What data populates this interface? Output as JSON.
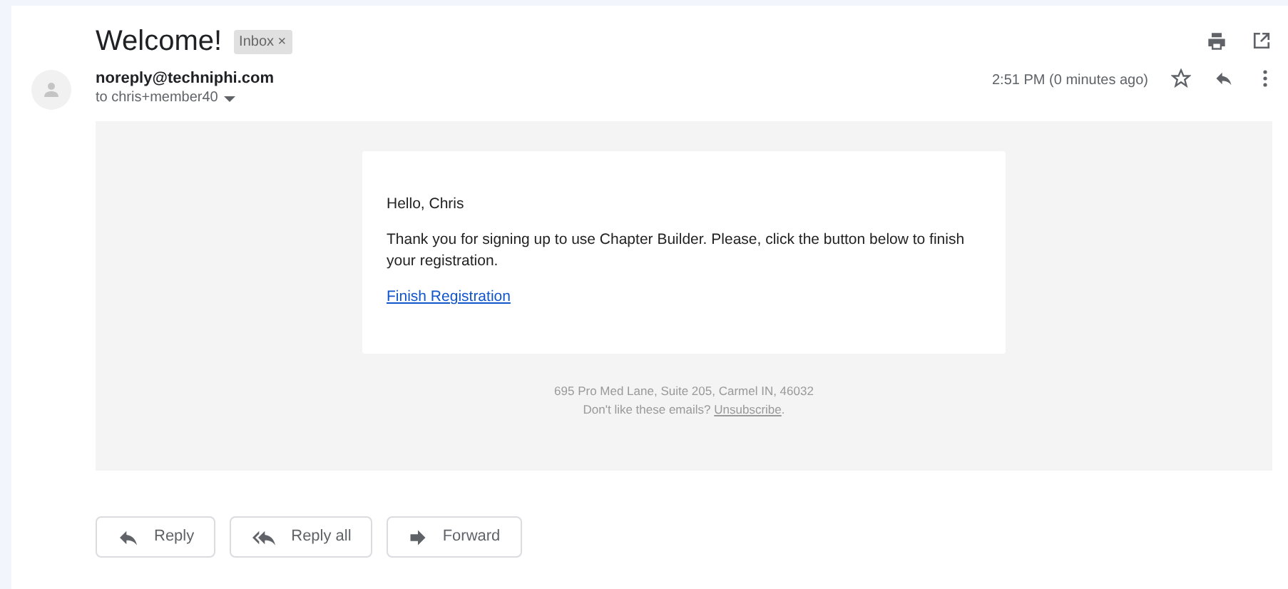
{
  "subject": "Welcome!",
  "label": {
    "text": "Inbox",
    "close": "×"
  },
  "sender": {
    "email": "noreply@techniphi.com",
    "recipient": "to chris+member40"
  },
  "time": "2:51 PM (0 minutes ago)",
  "starred": false,
  "body": {
    "greeting": "Hello, Chris",
    "message": "Thank you for signing up to use Chapter Builder. Please, click the button below to finish your registration.",
    "link": "Finish Registration"
  },
  "footer": {
    "address": "695 Pro Med Lane, Suite 205, Carmel IN, 46032",
    "prompt": "Don't like these emails?",
    "unsubscribe": "Unsubscribe",
    "end": "."
  },
  "actions": [
    {
      "kind": "reply",
      "label": "Reply"
    },
    {
      "kind": "reply-all",
      "label": "Reply all"
    },
    {
      "kind": "forward",
      "label": "Forward"
    }
  ]
}
